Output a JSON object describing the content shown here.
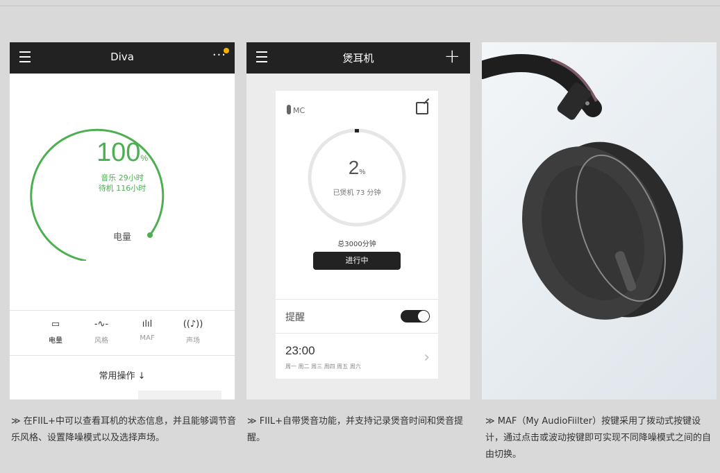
{
  "screen1": {
    "title": "Diva",
    "menu_dots": "···",
    "battery_percent": 100,
    "battery_value": "100",
    "percent_unit": "%",
    "music_time": "音乐 29小时",
    "standby_time": "待机 116小时",
    "gauge_label": "电量",
    "accent_color": "#4caf50",
    "tabs": [
      {
        "label": "电量",
        "icon": "battery-icon",
        "glyph": "▭",
        "active": true
      },
      {
        "label": "风格",
        "icon": "waveform-icon",
        "glyph": "-∿-",
        "active": false
      },
      {
        "label": "MAF",
        "icon": "sound-bars-icon",
        "glyph": "ılıl",
        "active": false
      },
      {
        "label": "声场",
        "icon": "surround-sound-icon",
        "glyph": "((♪))",
        "active": false
      }
    ],
    "common_ops": "常用操作 ↓"
  },
  "screen2": {
    "title": "煲耳机",
    "plus": "+",
    "device": "MC",
    "progress_percent": 2,
    "progress_value": "2",
    "percent_unit": "%",
    "spent": "已煲机 73 分钟",
    "total": "总3000分钟",
    "status_button": "进行中",
    "reminder_label": "提醒",
    "reminder_on": true,
    "reminder_time": "23:00",
    "reminder_days": "周一 周二 周三 周四 周五 周六",
    "chevron": "›"
  },
  "captions": [
    "≫ 在FIIL+中可以查看耳机的状态信息，并且能够调节音乐风格、设置降噪模式以及选择声场。",
    "≫ FIIL+自带煲音功能，并支持记录煲音时间和煲音提醒。",
    "≫ MAF（My AudioFiilter）按键采用了拨动式按键设计，通过点击或波动按键即可实现不同降噪模式之间的自由切换。"
  ]
}
